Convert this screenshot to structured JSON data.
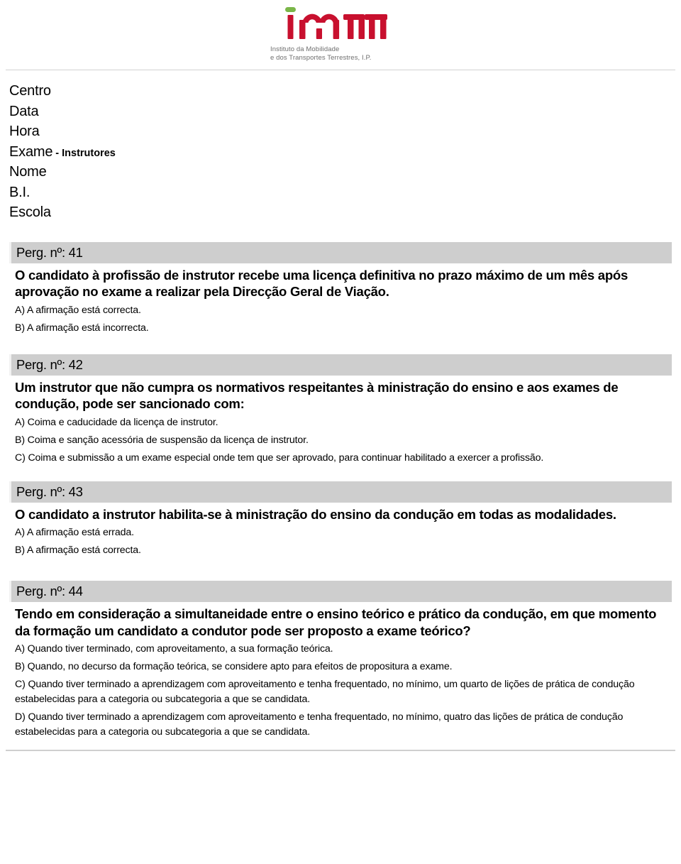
{
  "brand": {
    "logo_wordmark": "imtt",
    "logo_subtitle": "Instituto da Mobilidade\ne dos Transportes Terrestres, I.P.",
    "logo_color": "#c8102e",
    "logo_dot_color": "#7ab648",
    "logo_subtitle_color": "#6f6f6f"
  },
  "header_fields": [
    {
      "label": "Centro",
      "suffix": ""
    },
    {
      "label": "Data",
      "suffix": ""
    },
    {
      "label": "Hora",
      "suffix": ""
    },
    {
      "label": "Exame",
      "suffix": " - Instrutores"
    },
    {
      "label": "Nome",
      "suffix": ""
    },
    {
      "label": "B.I.",
      "suffix": ""
    },
    {
      "label": "Escola",
      "suffix": ""
    }
  ],
  "band_color": "#cecece",
  "questions": [
    {
      "band": "Perg. nº: 41",
      "number": "41",
      "stem": "O candidato à profissão de instrutor recebe uma licença definitiva no prazo máximo de um mês após aprovação no exame a realizar pela Direcção Geral de Viação.",
      "options": [
        "A) A afirmação está correcta.",
        "B) A afirmação está incorrecta."
      ]
    },
    {
      "band": "Perg. nº: 42",
      "number": "42",
      "stem": "Um instrutor que não cumpra os normativos respeitantes à ministração do ensino e aos exames de condução, pode ser sancionado com:",
      "options": [
        "A) Coima e caducidade da licença de instrutor.",
        "B) Coima e sanção acessória de suspensão da licença de instrutor.",
        "C) Coima e submissão a um exame especial onde tem que ser aprovado, para continuar habilitado a exercer a profissão."
      ]
    },
    {
      "band": "Perg. nº: 43",
      "number": "43",
      "stem": "O candidato a instrutor habilita-se à ministração do ensino da condução em todas as modalidades.",
      "options": [
        "A) A afirmação está errada.",
        "B) A afirmação está correcta."
      ]
    },
    {
      "band": "Perg. nº: 44",
      "number": "44",
      "stem": "Tendo em consideração a simultaneidade entre o ensino teórico e prático da condução, em que momento da formação um candidato a condutor pode ser proposto a exame teórico?",
      "options": [
        "A) Quando tiver terminado, com aproveitamento, a sua formação teórica.",
        "B) Quando, no decurso da formação teórica, se considere apto para efeitos de propositura a exame.",
        "C) Quando tiver terminado a aprendizagem com aproveitamento e tenha frequentado, no mínimo, um quarto de lições de prática de condução estabelecidas para a categoria ou subcategoria a que se candidata.",
        "D) Quando tiver terminado a aprendizagem com aproveitamento e tenha frequentado, no mínimo, quatro das lições de prática de condução estabelecidas para a categoria ou subcategoria a que se candidata."
      ]
    }
  ]
}
